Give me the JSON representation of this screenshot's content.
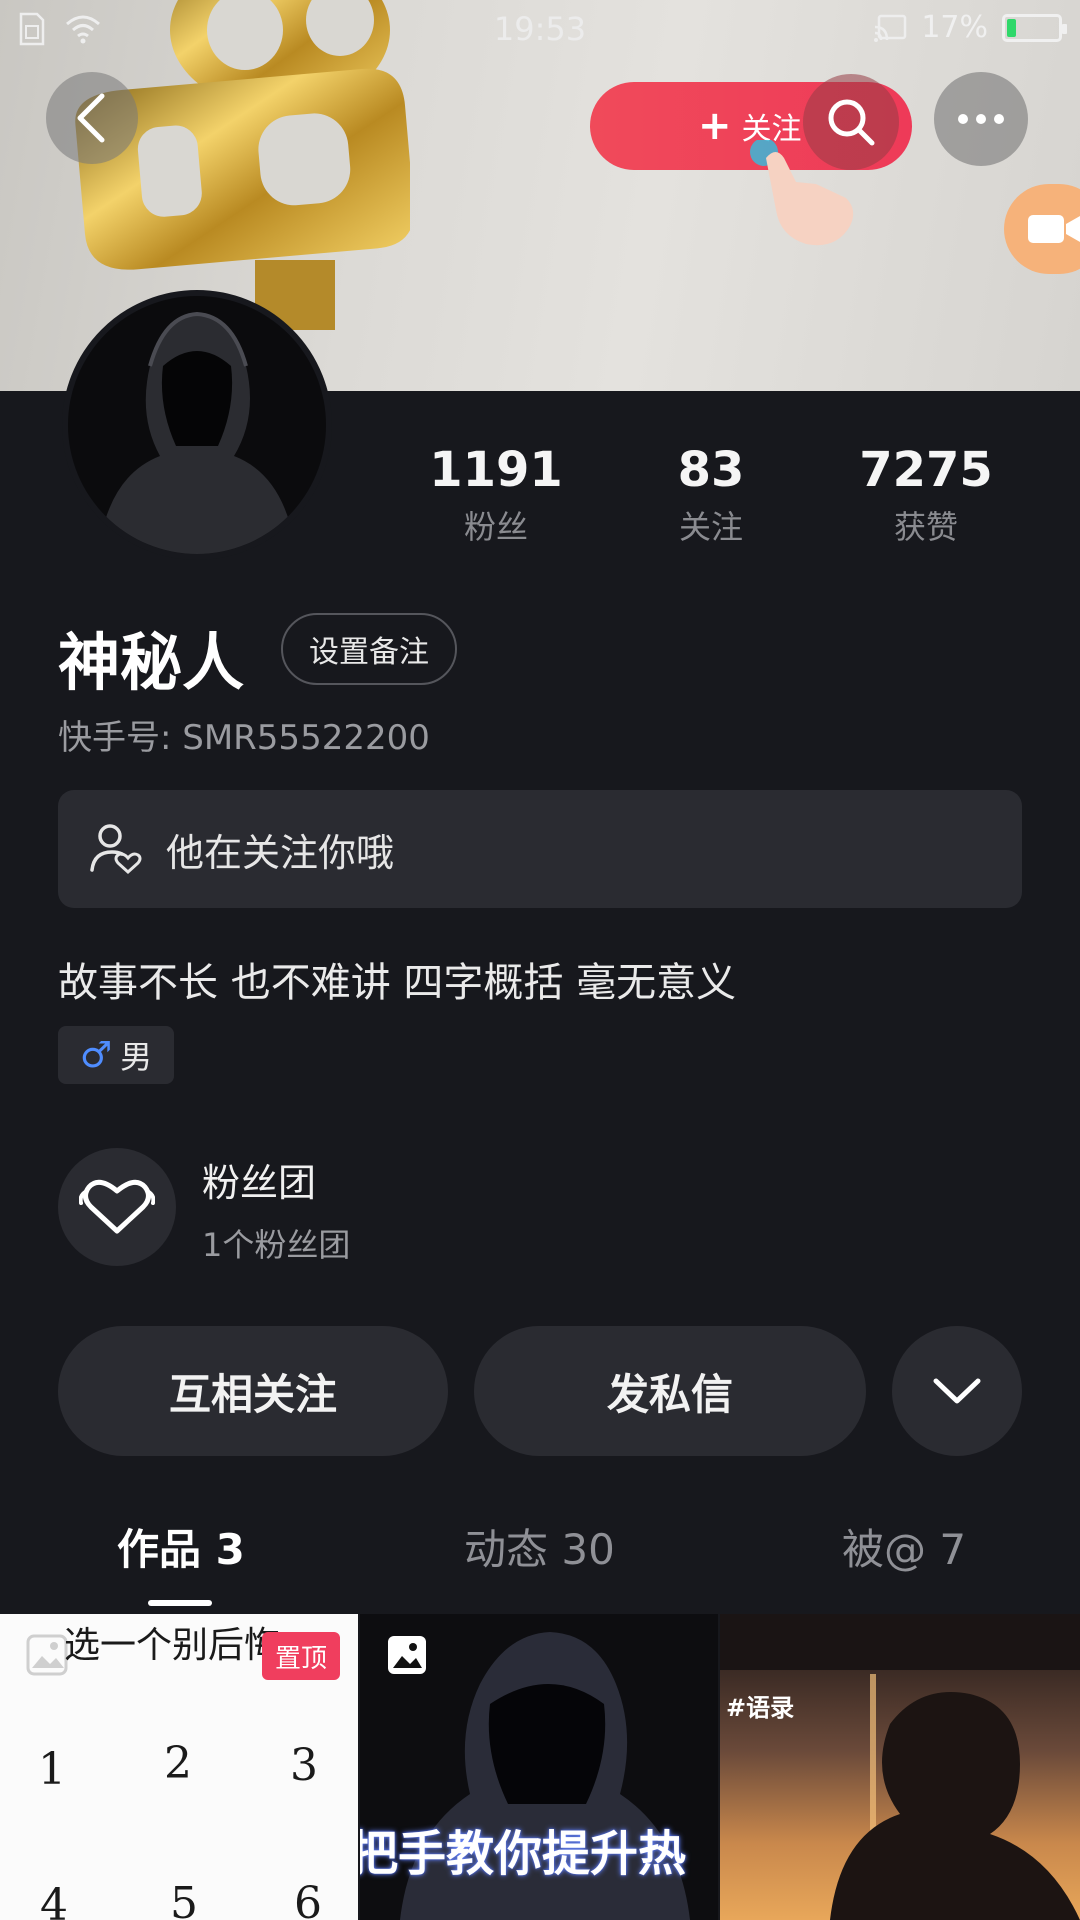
{
  "status_bar": {
    "time": "19:53",
    "battery_percent": "17%",
    "battery_level": 0.17
  },
  "header": {
    "follow_label": "关注",
    "colors": {
      "follow_button": "#ee3a58",
      "live_button": "#f6b27a"
    }
  },
  "stats": [
    {
      "value": "1191",
      "label": "粉丝"
    },
    {
      "value": "83",
      "label": "关注"
    },
    {
      "value": "7275",
      "label": "获赞"
    }
  ],
  "profile": {
    "name": "神秘人",
    "remark_button": "设置备注",
    "kuaishou_id": "快手号: SMR55522200",
    "follows_you": "他在关注你哦",
    "bio": "故事不长 也不难讲 四字概括 毫无意义",
    "gender_symbol": "♂",
    "gender": "男"
  },
  "fan_group": {
    "title": "粉丝团",
    "subtitle": "1个粉丝团"
  },
  "actions": {
    "mutual_follow": "互相关注",
    "message": "发私信"
  },
  "tabs": [
    {
      "label": "作品 3",
      "active": true
    },
    {
      "label": "动态 30",
      "active": false
    },
    {
      "label": "被@ 7",
      "active": false
    }
  ],
  "works": [
    {
      "title": "选一个别后悔",
      "badge": "置顶",
      "numbers": [
        "1",
        "2",
        "3",
        "4",
        "5",
        "6"
      ]
    },
    {
      "caption": "把手教你提升热"
    },
    {
      "tag": "#语录"
    }
  ]
}
